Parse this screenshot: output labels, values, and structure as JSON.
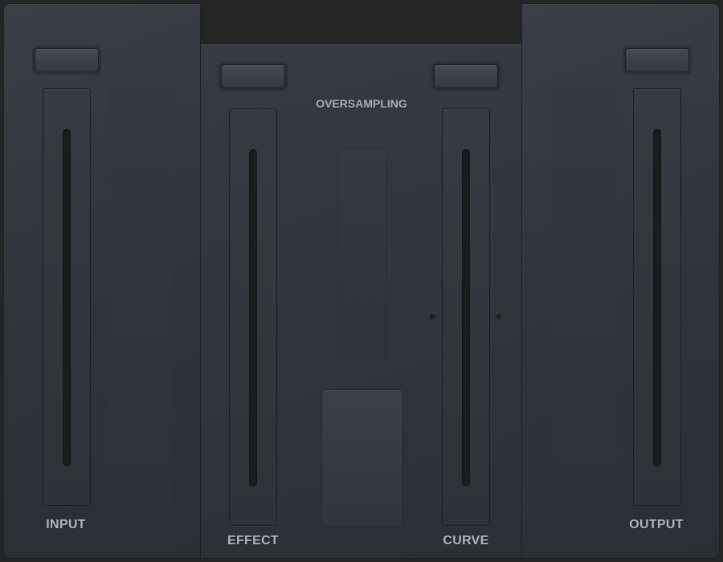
{
  "labels": {
    "input": "INPUT",
    "effect": "EFFECT",
    "oversampling": "OVERSAMPLING",
    "curve": "CURVE",
    "output": "OUTPUT"
  },
  "value_displays": {
    "input": "",
    "effect": "",
    "curve": "",
    "output": ""
  },
  "icons": {
    "curve_marker_left": "triangle-right-icon",
    "curve_marker_right": "triangle-left-icon"
  },
  "colors": {
    "background": "#252526",
    "panel": "#353a42",
    "track": "#1b1c1e",
    "label": "#b3b8bf"
  }
}
